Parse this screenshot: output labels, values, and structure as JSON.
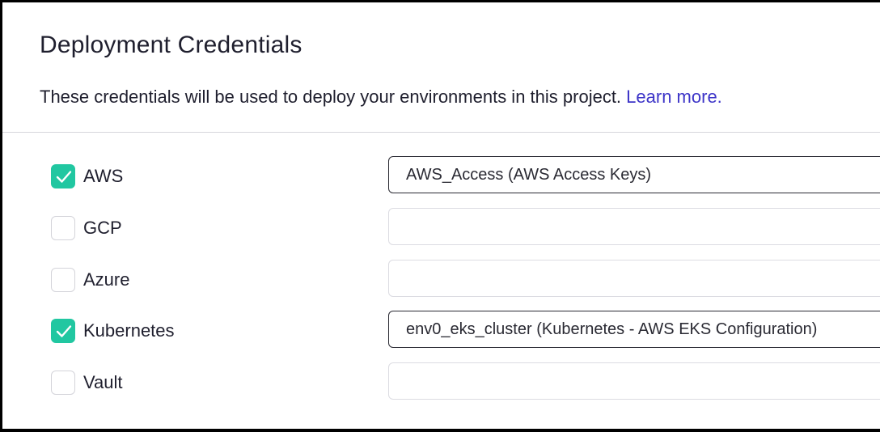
{
  "header": {
    "title": "Deployment Credentials",
    "description": "These credentials will be used to deploy your environments in this project.",
    "learn_more": "Learn more."
  },
  "accent_color": "#21c7a1",
  "link_color": "#3d35c8",
  "credentials": [
    {
      "label": "AWS",
      "checked": true,
      "value": "AWS_Access (AWS Access Keys)"
    },
    {
      "label": "GCP",
      "checked": false,
      "value": ""
    },
    {
      "label": "Azure",
      "checked": false,
      "value": ""
    },
    {
      "label": "Kubernetes",
      "checked": true,
      "value": "env0_eks_cluster (Kubernetes - AWS EKS Configuration)"
    },
    {
      "label": "Vault",
      "checked": false,
      "value": ""
    }
  ]
}
